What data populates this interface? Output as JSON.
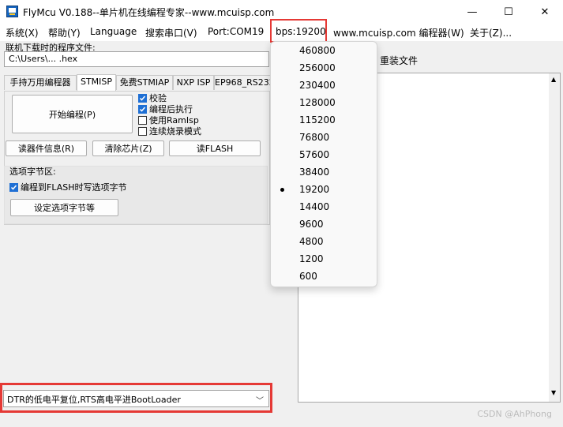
{
  "window": {
    "title": "FlyMcu V0.188--单片机在线编程专家--www.mcuisp.com",
    "minimize": "—",
    "maximize": "☐",
    "close": "✕"
  },
  "menu": {
    "items": [
      "系统(X)",
      "帮助(Y)",
      "Language",
      "搜索串口(V)",
      "Port:COM19",
      "bps:19200",
      "www.mcuisp.com 编程器(W)",
      "关于(Z)..."
    ]
  },
  "program_file": {
    "label": "联机下载时的程序文件:",
    "path": "C:\\Users\\... .hex",
    "reload_label": "重装文件"
  },
  "tabs": [
    "手持万用编程器",
    "STMISP",
    "免费STMIAP",
    "NXP ISP",
    "EP968_RS232"
  ],
  "stmisp": {
    "start_button": "开始编程(P)",
    "checks": [
      {
        "label": "校验",
        "checked": true
      },
      {
        "label": "编程后执行",
        "checked": true
      },
      {
        "label": "使用RamIsp",
        "checked": false
      },
      {
        "label": "连续烧录模式",
        "checked": false
      }
    ],
    "read_info_button": "读器件信息(R)",
    "erase_button": "清除芯片(Z)",
    "read_flash_button": "读FLASH",
    "option_group_label": "选项字节区:",
    "option_check": {
      "label": "编程到FLASH时写选项字节",
      "checked": true
    },
    "set_option_button": "设定选项字节等"
  },
  "boot_mode": {
    "selected": "DTR的低电平复位,RTS高电平进BootLoader"
  },
  "bps_dropdown": {
    "options": [
      "460800",
      "256000",
      "230400",
      "128000",
      "115200",
      "76800",
      "57600",
      "38400",
      "19200",
      "14400",
      "9600",
      "4800",
      "1200",
      "600"
    ],
    "selected": "19200"
  },
  "watermark": "CSDN @AhPhong",
  "colors": {
    "highlight": "#e53935",
    "checkbox": "#1e6fd4"
  }
}
